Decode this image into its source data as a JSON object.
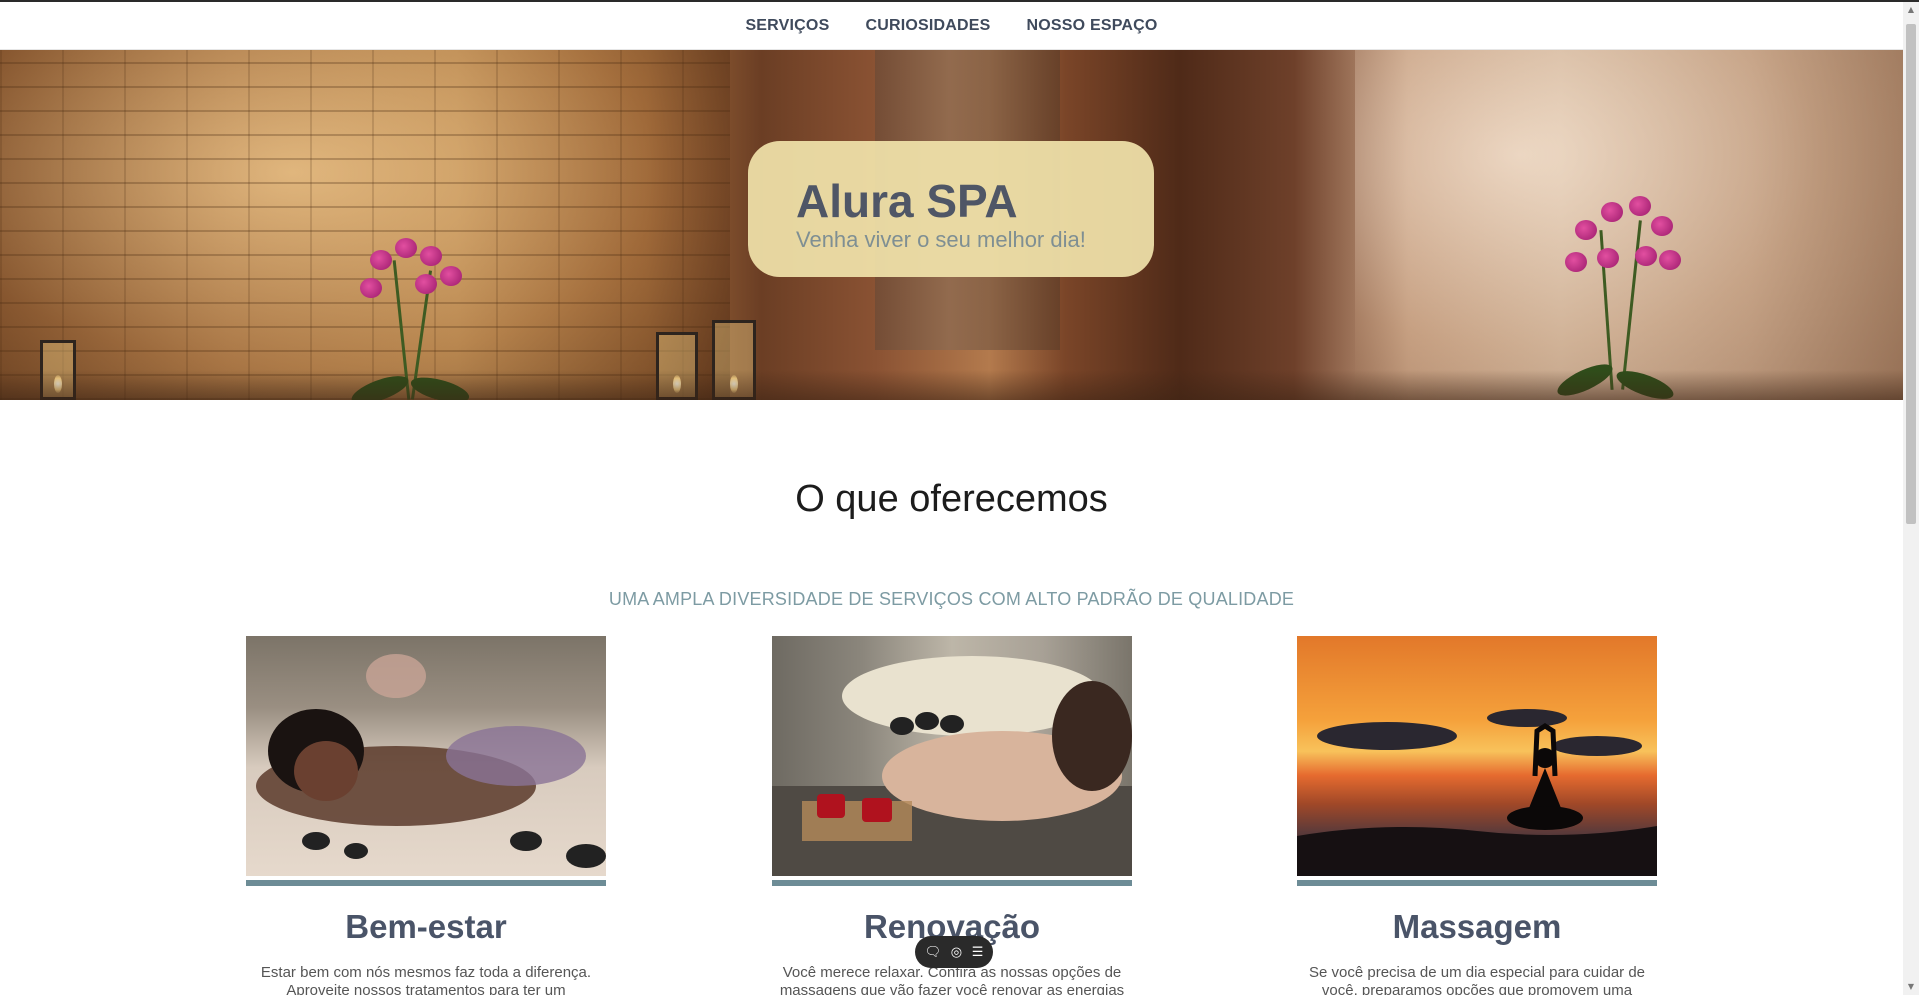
{
  "nav": {
    "items": [
      {
        "label": "SERVIÇOS"
      },
      {
        "label": "CURIOSIDADES"
      },
      {
        "label": "NOSSO ESPAÇO"
      }
    ]
  },
  "hero": {
    "title": "Alura SPA",
    "subtitle": "Venha viver o seu melhor dia!"
  },
  "services": {
    "title": "O que oferecemos",
    "subtitle": "UMA AMPLA DIVERSIDADE DE SERVIÇOS COM ALTO PADRÃO DE QUALIDADE",
    "cards": [
      {
        "title": "Bem-estar",
        "text": "Estar bem com nós mesmos faz toda a diferença. Aproveite nossos tratamentos para ter um"
      },
      {
        "title": "Renovação",
        "text": "Você merece relaxar. Confira as nossas opções de massagens que vão fazer você renovar as energias"
      },
      {
        "title": "Massagem",
        "text": "Se você precisa de um dia especial para cuidar de você, preparamos opções que promovem uma"
      }
    ]
  },
  "toolbar": {
    "icons": [
      "comment-icon",
      "eye-icon",
      "menu-icon"
    ]
  },
  "colors": {
    "accent": "#6d8c96",
    "nav_text": "#3f4a5c",
    "hero_card": "#f0e2aa",
    "subtitle": "#7d9ba3"
  }
}
